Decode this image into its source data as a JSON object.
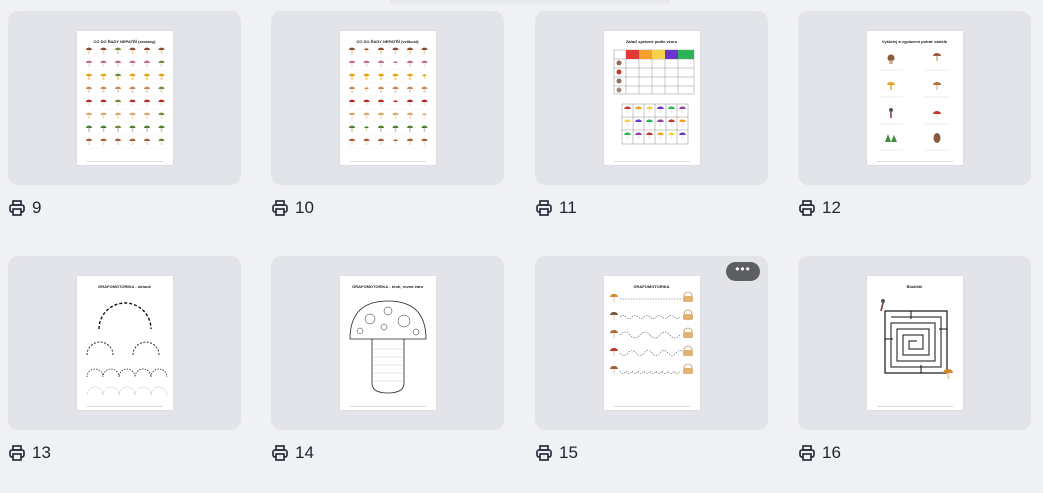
{
  "items": [
    {
      "number": "9",
      "title": "CO DO ŘADY NEPATŘÍ (sestavy)"
    },
    {
      "number": "10",
      "title": "CO DO ŘADY NEPATŘÍ (velikost)"
    },
    {
      "number": "11",
      "title": "Zařaď správně podle vzoru"
    },
    {
      "number": "12",
      "title": "Vyškrtej a vyplavení potrať obdélk"
    },
    {
      "number": "13",
      "title": "GRAFOMOTORIKA - oblouk"
    },
    {
      "number": "14",
      "title": "GRAFOMOTORIKA - kruh, rovná čára"
    },
    {
      "number": "15",
      "title": "GRAFOMOTORIKA"
    },
    {
      "number": "16",
      "title": "Bludiště"
    }
  ],
  "more_button": {
    "label": "•••"
  },
  "icons": {
    "print": "printer-icon",
    "more": "more-options-icon"
  },
  "colors": {
    "background": "#f0f1f5",
    "card": "#e3e4e9",
    "more_button": "#5e5f63"
  }
}
